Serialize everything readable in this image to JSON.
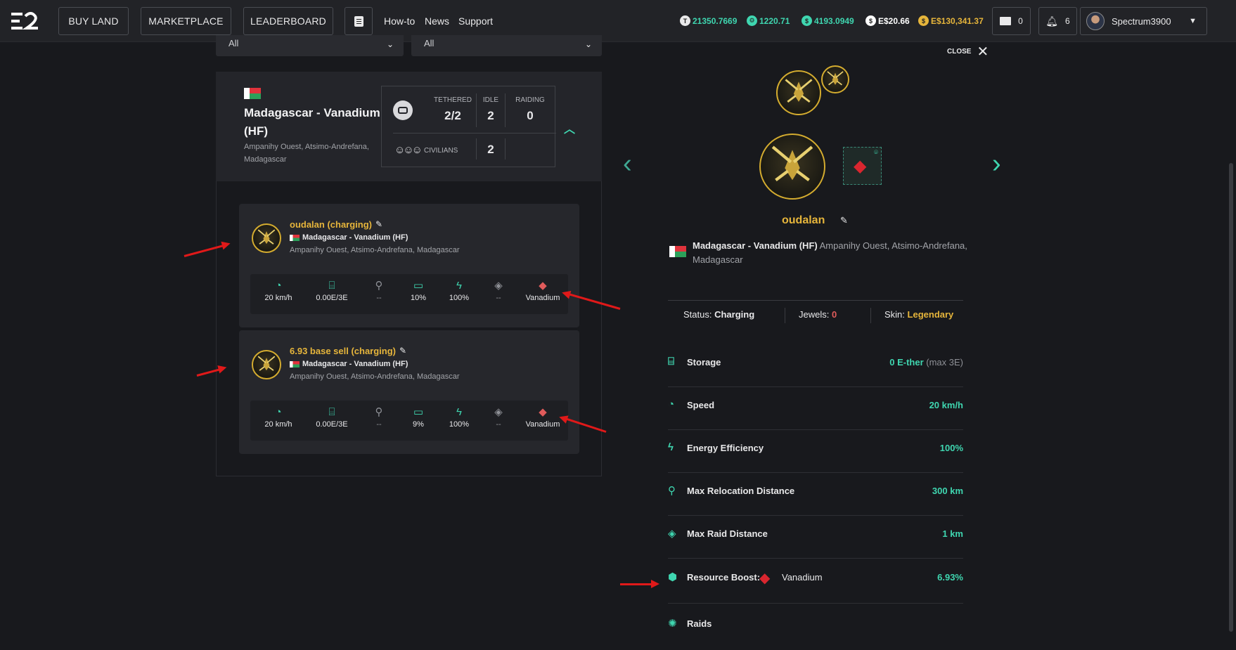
{
  "nav": {
    "buy_land": "BUY LAND",
    "marketplace": "MARKETPLACE",
    "leaderboard": "LEADERBOARD",
    "links": [
      "How-to",
      "News",
      "Support"
    ],
    "currencies": [
      {
        "icon": "t1-icon",
        "value": "21350.7669",
        "color": "#3fd6b0"
      },
      {
        "icon": "gear-coin-icon",
        "value": "1220.71",
        "color": "#3fd6b0"
      },
      {
        "icon": "ether-coin-icon",
        "value": "4193.0949",
        "color": "#3fd6b0"
      },
      {
        "icon": "dollar-icon",
        "value": "E$20.66",
        "color": "#ffffff"
      },
      {
        "icon": "gold-coin-icon",
        "value": "E$130,341.37",
        "color": "#e6b53b"
      }
    ],
    "mail_count": "0",
    "notif_count": "6",
    "username": "Spectrum3900"
  },
  "filters": {
    "first": "All",
    "second": "All"
  },
  "land": {
    "title_line1": "Madagascar - Vanadium",
    "title_line2": "(HF)",
    "address_line1": "Ampanihy Ouest, Atsimo-Andrefana,",
    "address_line2": "Madagascar",
    "tethered_label": "TETHERED",
    "tethered_value": "2/2",
    "idle_label": "IDLE",
    "idle_value": "2",
    "raiding_label": "RAIDING",
    "raiding_value": "0",
    "civilians_label": "CIVILIANS",
    "civilians_value": "2"
  },
  "drones": [
    {
      "name": "oudalan (charging)",
      "land": "Madagascar - Vanadium (HF)",
      "address": "Ampanihy Ouest, Atsimo-Andrefana, Madagascar",
      "stats": {
        "speed": "20 km/h",
        "storage": "0.00E/3E",
        "relocation": "--",
        "battery": "10%",
        "efficiency": "100%",
        "raid": "--",
        "resource": "Vanadium"
      }
    },
    {
      "name": "6.93 base sell (charging)",
      "land": "Madagascar - Vanadium (HF)",
      "address": "Ampanihy Ouest, Atsimo-Andrefana, Madagascar",
      "stats": {
        "speed": "20 km/h",
        "storage": "0.00E/3E",
        "relocation": "--",
        "battery": "9%",
        "efficiency": "100%",
        "raid": "--",
        "resource": "Vanadium"
      }
    }
  ],
  "detail": {
    "close": "CLOSE",
    "name": "oudalan",
    "land": "Madagascar - Vanadium (HF)",
    "address_inline": "Ampanihy Ouest, Atsimo-Andrefana,",
    "address_line2": "Madagascar",
    "status_label": "Status:",
    "status_value": "Charging",
    "jewels_label": "Jewels:",
    "jewels_value": "0",
    "skin_label": "Skin:",
    "skin_value": "Legendary",
    "rows": [
      {
        "label": "Storage",
        "value": "0 E-ther",
        "suffix": "(max 3E)"
      },
      {
        "label": "Speed",
        "value": "20 km/h"
      },
      {
        "label": "Energy Efficiency",
        "value": "100%"
      },
      {
        "label": "Max Relocation Distance",
        "value": "300 km"
      },
      {
        "label": "Max Raid Distance",
        "value": "1 km"
      },
      {
        "label": "Resource Boost:",
        "resource": "Vanadium",
        "value": "6.93%"
      },
      {
        "label": "Raids"
      }
    ]
  },
  "colors": {
    "accent": "#3fd6b0",
    "gold": "#e6b53b",
    "bg": "#18191d",
    "panel": "#24252a"
  }
}
